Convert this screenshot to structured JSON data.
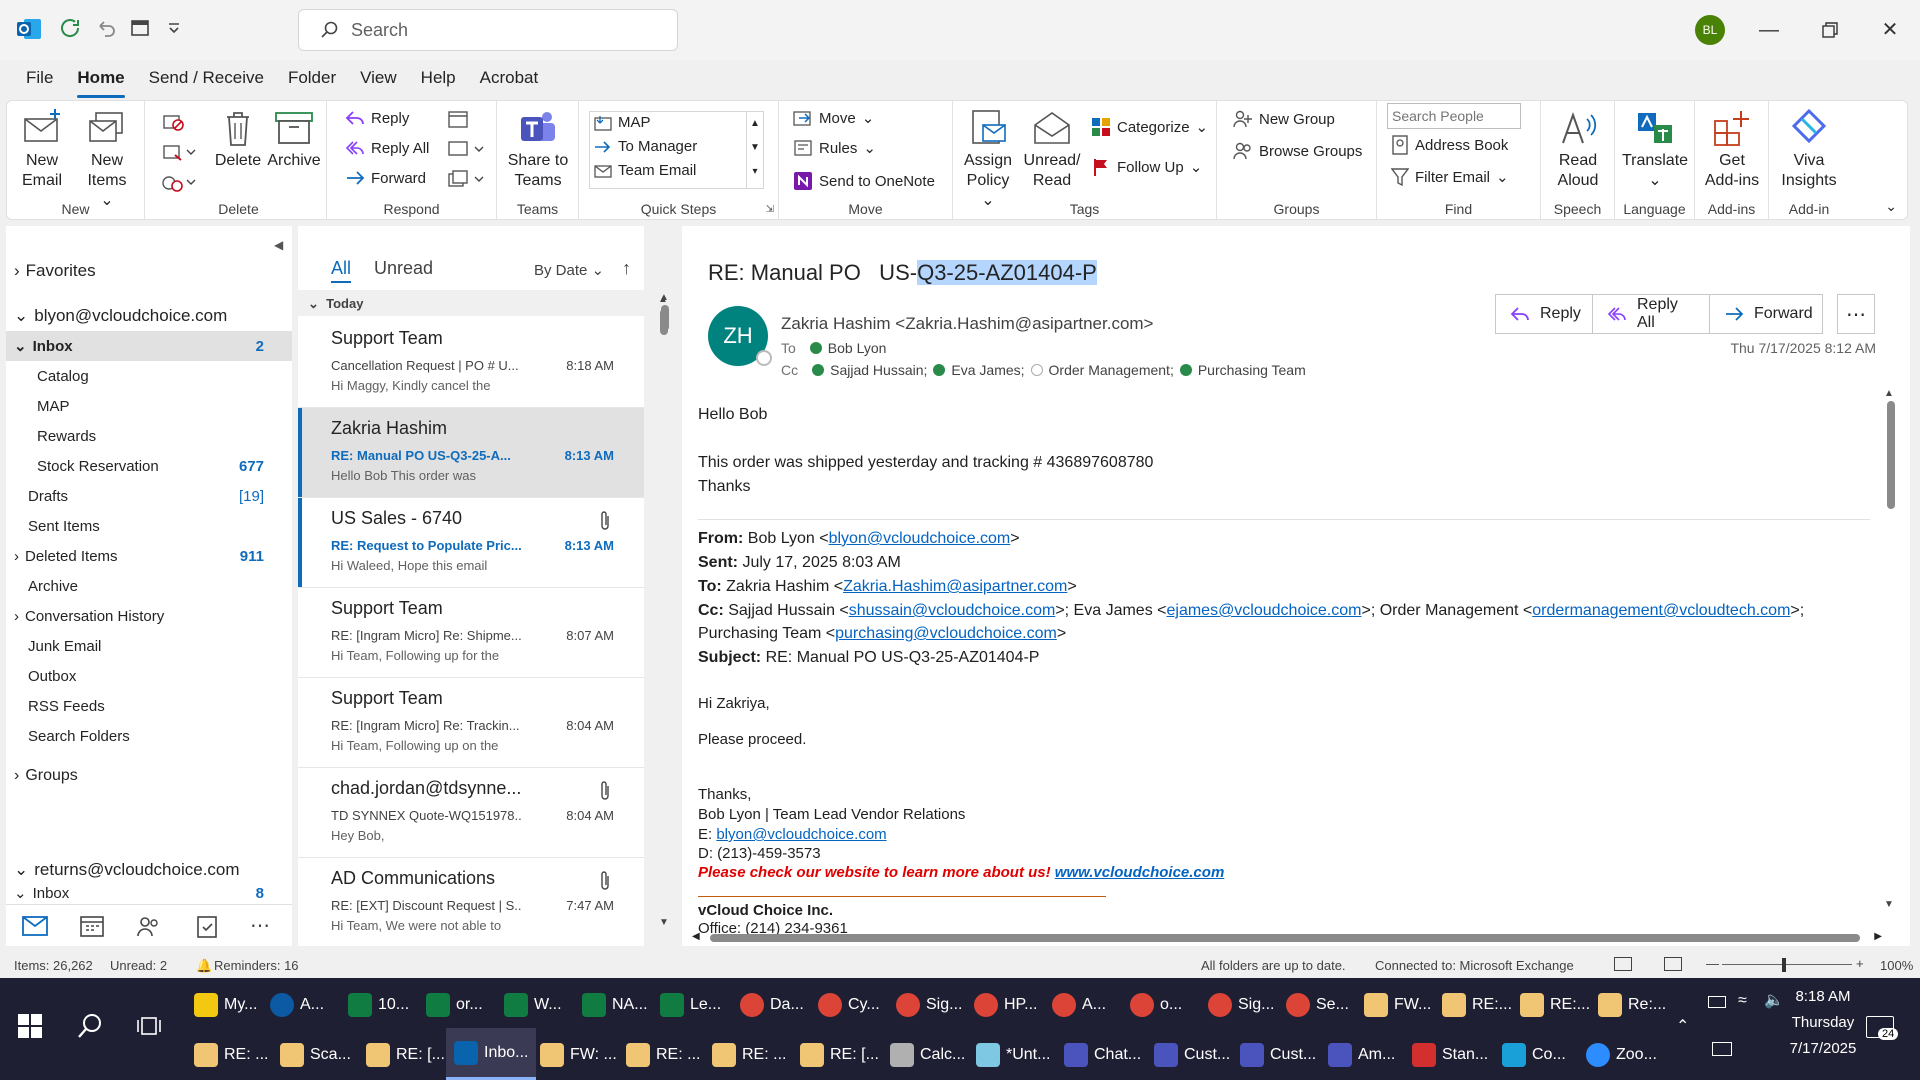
{
  "titlebar": {
    "search_placeholder": "Search",
    "avatar_initials": "BL"
  },
  "menu": [
    "File",
    "Home",
    "Send / Receive",
    "Folder",
    "View",
    "Help",
    "Acrobat"
  ],
  "ribbon": {
    "new_email": "New Email",
    "new_email_1": "New",
    "new_email_2": "Email",
    "new_items_1": "New",
    "new_items_2": "Items",
    "delete": "Delete",
    "archive": "Archive",
    "reply": "Reply",
    "reply_all": "Reply All",
    "forward": "Forward",
    "share_teams_1": "Share to",
    "share_teams_2": "Teams",
    "quick_steps": [
      "MAP",
      "To Manager",
      "Team Email"
    ],
    "move": "Move",
    "rules": "Rules",
    "send_onenote": "Send to OneNote",
    "assign_policy_1": "Assign",
    "assign_policy_2": "Policy",
    "unread_read_1": "Unread/",
    "unread_read_2": "Read",
    "categorize": "Categorize",
    "follow_up": "Follow Up",
    "new_group": "New Group",
    "browse_groups": "Browse Groups",
    "search_people_placeholder": "Search People",
    "address_book": "Address Book",
    "filter_email": "Filter Email",
    "read_aloud_1": "Read",
    "read_aloud_2": "Aloud",
    "translate": "Translate",
    "get_addins_1": "Get",
    "get_addins_2": "Add-ins",
    "viva_1": "Viva",
    "viva_2": "Insights",
    "groups": [
      "New",
      "Delete",
      "Respond",
      "Teams",
      "Quick Steps",
      "Move",
      "Tags",
      "Groups",
      "Find",
      "Speech",
      "Language",
      "Add-ins",
      "Add-in"
    ]
  },
  "folders": {
    "favorites": "Favorites",
    "account1": "blyon@vcloudchoice.com",
    "inbox": "Inbox",
    "inbox_count": "2",
    "catalog": "Catalog",
    "map": "MAP",
    "rewards": "Rewards",
    "stock": "Stock Reservation",
    "stock_count": "677",
    "drafts": "Drafts",
    "drafts_count": "[19]",
    "sent": "Sent Items",
    "deleted": "Deleted Items",
    "deleted_count": "911",
    "archive": "Archive",
    "conv": "Conversation History",
    "junk": "Junk Email",
    "outbox": "Outbox",
    "rss": "RSS Feeds",
    "search_folders": "Search Folders",
    "groups": "Groups",
    "account2": "returns@vcloudchoice.com",
    "inbox2": "Inbox",
    "inbox2_count": "8"
  },
  "list": {
    "tab_all": "All",
    "tab_unread": "Unread",
    "sort": "By Date",
    "section": "Today",
    "messages": [
      {
        "from": "Support Team",
        "subject": "Cancellation Request | PO # U...",
        "time": "8:18 AM",
        "preview": "Hi Maggy,  Kindly cancel the"
      },
      {
        "from": "Zakria Hashim",
        "subject": "RE: Manual PO   US-Q3-25-A...",
        "time": "8:13 AM",
        "preview": "Hello Bob  This order was"
      },
      {
        "from": "US Sales - 6740",
        "subject": "RE: Request to Populate Pric...",
        "time": "8:13 AM",
        "preview": "Hi Waleed,  Hope this email"
      },
      {
        "from": "Support Team",
        "subject": "RE: [Ingram Micro] Re: Shipme...",
        "time": "8:07 AM",
        "preview": "Hi Team,  Following up for the"
      },
      {
        "from": "Support Team",
        "subject": "RE: [Ingram Micro] Re: Trackin...",
        "time": "8:04 AM",
        "preview": "Hi Team,  Following up on the"
      },
      {
        "from": "chad.jordan@tdsynne...",
        "subject": "TD SYNNEX Quote-WQ151978...",
        "time": "8:04 AM",
        "preview": "Hey Bob,"
      },
      {
        "from": "AD Communications",
        "subject": "RE: [EXT] Discount Request | S...",
        "time": "7:47 AM",
        "preview": "Hi Team,   We were not able to"
      }
    ]
  },
  "reading": {
    "subject_prefix": "RE: Manual PO   US-",
    "subject_highlight": "Q3-25-AZ01404-P",
    "sender_initials": "ZH",
    "sender": "Zakria Hashim <Zakria.Hashim@asipartner.com>",
    "to_label": "To",
    "to": "Bob Lyon",
    "cc_label": "Cc",
    "cc": [
      "Sajjad Hussain;",
      "Eva James;",
      "Order Management;",
      "Purchasing Team"
    ],
    "reply": "Reply",
    "reply_all": "Reply All",
    "forward": "Forward",
    "date": "Thu 7/17/2025 8:12 AM",
    "hello": "Hello Bob",
    "line1": "This order was shipped yesterday and tracking # 436897608780",
    "thanks": "Thanks",
    "from_label": "From:",
    "from_name": "Bob Lyon <",
    "from_email": "blyon@vcloudchoice.com",
    "gt": ">",
    "sent_label": "Sent:",
    "sent": "July 17, 2025 8:03 AM",
    "to2_label": "To:",
    "to2_name": "Zakria Hashim <",
    "to2_email": "Zakria.Hashim@asipartner.com",
    "cc2_label": "Cc:",
    "cc2_a": "Sajjad Hussain <",
    "cc2_a_email": "shussain@vcloudchoice.com",
    "cc2_b": ">; Eva James <",
    "cc2_b_email": "ejames@vcloudchoice.com",
    "cc2_c": ">; Order Management <",
    "cc2_c_email": "ordermanagement@vcloudtech.com",
    "cc2_end": ">;",
    "cc2_d": "Purchasing Team <",
    "cc2_d_email": "purchasing@vcloudchoice.com",
    "subj_label": "Subject:",
    "subj": "RE: Manual PO US-Q3-25-AZ01404-P",
    "hi": "Hi Zakriya,",
    "proceed": "Please proceed.",
    "thanks2": "Thanks,",
    "sig_name": "Bob Lyon | Team Lead Vendor Relations",
    "sig_e_label": "E: ",
    "sig_e": "blyon@vcloudchoice.com",
    "sig_d": "D: (213)-459-3573",
    "promo": "Please check our website to learn more about us!",
    "promo_link": "www.vcloudchoice.com",
    "company": "vCloud Choice Inc.",
    "office": "Office: (214) 234-9361"
  },
  "status": {
    "items": "Items: 26,262",
    "unread": "Unread: 2",
    "reminders": "Reminders: 16",
    "sync": "All folders are up to date.",
    "conn": "Connected to: Microsoft Exchange",
    "zoom": "100%"
  },
  "taskbar": {
    "row1": [
      "My...",
      "A...",
      "10...",
      "or...",
      "W...",
      "NA...",
      "Le...",
      "Da...",
      "Cy...",
      "Sig...",
      "HP...",
      "A...",
      "o...",
      "Sig...",
      "Se...",
      "FW...",
      "RE:...",
      "RE:...",
      "Re:..."
    ],
    "row2": [
      "RE: ...",
      "Sca...",
      "RE: [...",
      "Inbo...",
      "FW: ...",
      "RE: ...",
      "RE: ...",
      "RE: [...",
      "Calc...",
      "*Unt...",
      "Chat...",
      "Cust...",
      "Cust...",
      "Am...",
      "Stan...",
      "Co...",
      "Zoo..."
    ],
    "time": "8:18 AM",
    "day": "Thursday",
    "date": "7/17/2025",
    "notif": "24"
  },
  "colors": {
    "accent": "#0f6cbd",
    "avatar": "#498205",
    "sender_avatar": "#00827f",
    "promo": "#e00000"
  }
}
